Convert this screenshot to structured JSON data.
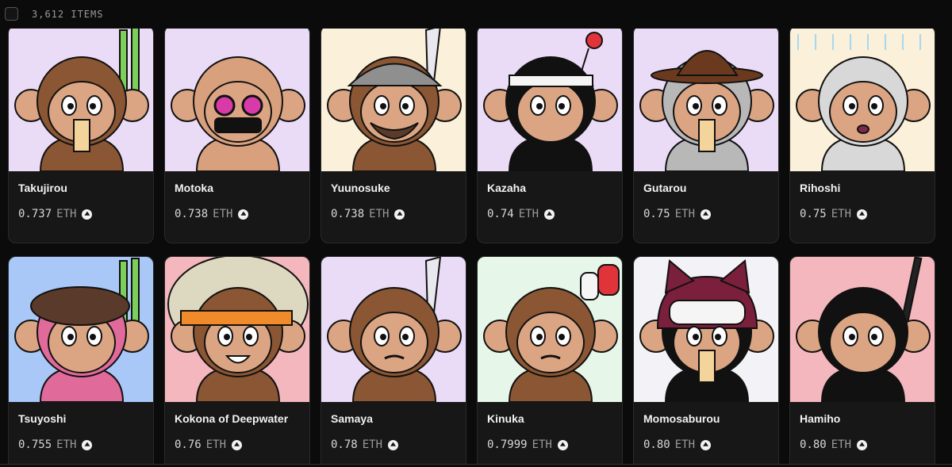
{
  "header": {
    "item_count": "3,612 ITEMS"
  },
  "currency": "ETH",
  "cards": [
    {
      "name": "Takujirou",
      "price": "0.737",
      "bg": "#eadcf7",
      "fur": "#8a5633",
      "face": "#dba583",
      "accessory": "bamboo",
      "hat": "",
      "mouth": "noodles"
    },
    {
      "name": "Motoka",
      "price": "0.738",
      "bg": "#eadcf7",
      "fur": "#d9a07d",
      "face": "#dba583",
      "accessory": "goggles",
      "hat": "bald",
      "mouth": "mask"
    },
    {
      "name": "Yuunosuke",
      "price": "0.738",
      "bg": "#fbf0d9",
      "fur": "#8a5633",
      "face": "#dba583",
      "accessory": "blade",
      "hat": "bandana",
      "mouth": "beard"
    },
    {
      "name": "Kazaha",
      "price": "0.74",
      "bg": "#eadcf7",
      "fur": "#111111",
      "face": "#dba583",
      "accessory": "apple",
      "hat": "beanie",
      "mouth": "none"
    },
    {
      "name": "Gutarou",
      "price": "0.75",
      "bg": "#eadcf7",
      "fur": "#b8b8b8",
      "face": "#dba583",
      "accessory": "",
      "hat": "bowler",
      "mouth": "noodles"
    },
    {
      "name": "Rihoshi",
      "price": "0.75",
      "bg": "#fbf0d9",
      "fur": "#d8d8d8",
      "face": "#dba583",
      "accessory": "rain",
      "hat": "",
      "mouth": "open"
    },
    {
      "name": "Tsuyoshi",
      "price": "0.755",
      "bg": "#a9c7f7",
      "fur": "#e06a9a",
      "face": "#dba583",
      "accessory": "bamboo",
      "hat": "beret",
      "mouth": "none"
    },
    {
      "name": "Kokona of Deepwater",
      "price": "0.76",
      "bg": "#f4b7bd",
      "fur": "#8a5633",
      "face": "#dba583",
      "accessory": "afro",
      "hat": "fire",
      "mouth": "smile"
    },
    {
      "name": "Samaya",
      "price": "0.78",
      "bg": "#eadcf7",
      "fur": "#8a5633",
      "face": "#dba583",
      "accessory": "blade",
      "hat": "",
      "mouth": "mustache"
    },
    {
      "name": "Kinuka",
      "price": "0.7999",
      "bg": "#e6f7ea",
      "fur": "#8a5633",
      "face": "#dba583",
      "accessory": "lanterns",
      "hat": "",
      "mouth": "mustache"
    },
    {
      "name": "Momosaburou",
      "price": "0.80",
      "bg": "#f3f3f7",
      "fur": "#111111",
      "face": "#dba583",
      "accessory": "",
      "hat": "cat",
      "mouth": "noodles"
    },
    {
      "name": "Hamiho",
      "price": "0.80",
      "bg": "#f4b7bd",
      "fur": "#111111",
      "face": "#dba583",
      "accessory": "sword",
      "hat": "",
      "mouth": "none"
    }
  ]
}
